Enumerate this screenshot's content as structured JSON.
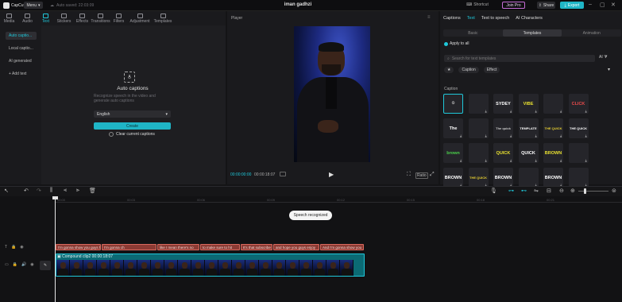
{
  "app": {
    "name": "CapCut",
    "menu_label": "Menu",
    "autosave": "Auto saved: 22:03:09",
    "project_title": "iman gadhzi"
  },
  "topbar": {
    "shortcut_label": "Shortcut",
    "join_pro_label": "Join Pro",
    "share_label": "Share",
    "export_label": "Export"
  },
  "tools": [
    {
      "label": "Media"
    },
    {
      "label": "Audio"
    },
    {
      "label": "Text"
    },
    {
      "label": "Stickers"
    },
    {
      "label": "Effects"
    },
    {
      "label": "Transitions"
    },
    {
      "label": "Filters"
    },
    {
      "label": "Adjustment"
    },
    {
      "label": "Templates"
    }
  ],
  "left_nav": [
    {
      "label": "Auto captio..."
    },
    {
      "label": "Local captio..."
    },
    {
      "label": "AI generated"
    },
    {
      "label": "+ Add text"
    }
  ],
  "captions_panel": {
    "title": "Auto captions",
    "description": "Recognize speech in the video and generate auto captions",
    "language": "English",
    "create_label": "Create",
    "clear_label": "Clear current captions"
  },
  "player": {
    "label": "Player",
    "current_time": "00:00:00:00",
    "total_time": "00:00:18:07",
    "ratio_label": "Ratio"
  },
  "right_panel": {
    "tabs": [
      {
        "label": "Captions"
      },
      {
        "label": "Text"
      },
      {
        "label": "Text to speech"
      },
      {
        "label": "AI Characters"
      }
    ],
    "subtabs": [
      {
        "label": "Basic"
      },
      {
        "label": "Templates"
      },
      {
        "label": "Animation"
      }
    ],
    "apply_all": "Apply to all",
    "search_placeholder": "Search for text templates",
    "ai_label": "AI",
    "filters": [
      {
        "label": "★"
      },
      {
        "label": "Caption"
      },
      {
        "label": "Effect"
      }
    ],
    "section": "Caption",
    "tiles": [
      {
        "text": "⦸",
        "bg": "#25252a",
        "fg": "#bbb"
      },
      {
        "text": "",
        "bg": "#25252a",
        "fg": "#fff"
      },
      {
        "text": "SYDEY",
        "bg": "#25252a",
        "fg": "#fff"
      },
      {
        "text": "VIBE",
        "bg": "#25252a",
        "fg": "#e8e030"
      },
      {
        "text": "",
        "bg": "#25252a",
        "fg": "#fff"
      },
      {
        "text": "CLICK",
        "bg": "#25252a",
        "fg": "#e84a4a"
      },
      {
        "text": "The",
        "bg": "#25252a",
        "fg": "#fff"
      },
      {
        "text": "",
        "bg": "#25252a",
        "fg": "#fff"
      },
      {
        "text": "The quick",
        "bg": "#25252a",
        "fg": "#ccc"
      },
      {
        "text": "TEMPLATE",
        "bg": "#25252a",
        "fg": "#fff"
      },
      {
        "text": "THE QUICK",
        "bg": "#25252a",
        "fg": "#e8d030"
      },
      {
        "text": "THE QUICK",
        "bg": "#25252a",
        "fg": "#fff"
      },
      {
        "text": "brown",
        "bg": "#25252a",
        "fg": "#4ad04a"
      },
      {
        "text": "",
        "bg": "#25252a",
        "fg": "#fff"
      },
      {
        "text": "QUICK",
        "bg": "#25252a",
        "fg": "#e8e030"
      },
      {
        "text": "QUICK",
        "bg": "#25252a",
        "fg": "#fff"
      },
      {
        "text": "BROWN",
        "bg": "#25252a",
        "fg": "#e8e030"
      },
      {
        "text": "",
        "bg": "#25252a",
        "fg": "#fff"
      },
      {
        "text": "BROWN",
        "bg": "#25252a",
        "fg": "#fff"
      },
      {
        "text": "THE QUICK",
        "bg": "#25252a",
        "fg": "#e8d030"
      },
      {
        "text": "BROWN",
        "bg": "#25252a",
        "fg": "#fff"
      },
      {
        "text": "",
        "bg": "#25252a",
        "fg": "#fff"
      },
      {
        "text": "BROWN",
        "bg": "#25252a",
        "fg": "#fff"
      },
      {
        "text": "",
        "bg": "#25252a",
        "fg": "#fff"
      }
    ]
  },
  "timeline": {
    "ticks": [
      "00:00",
      "00:03",
      "00:06",
      "00:09",
      "00:12",
      "00:15",
      "00:18",
      "00:21"
    ],
    "toast": "Speech recognized",
    "caption_clips": [
      {
        "text": "I'm gonna show you guys how"
      },
      {
        "text": "I'm gonna ch"
      },
      {
        "text": "like I mean there's no"
      },
      {
        "text": "to make sure to hit"
      },
      {
        "text": "It's that subscribe"
      },
      {
        "text": "and hope you guys enjoy"
      },
      {
        "text": "And I'm gonna show you"
      }
    ],
    "video_clip": {
      "name": "Compound clip2",
      "duration": "00:00:18:07"
    },
    "cover_label": "Cover"
  },
  "colors": {
    "accent": "#1fc7d9",
    "caption_clip": "#8c3b34",
    "video_clip": "#0b6a74"
  }
}
